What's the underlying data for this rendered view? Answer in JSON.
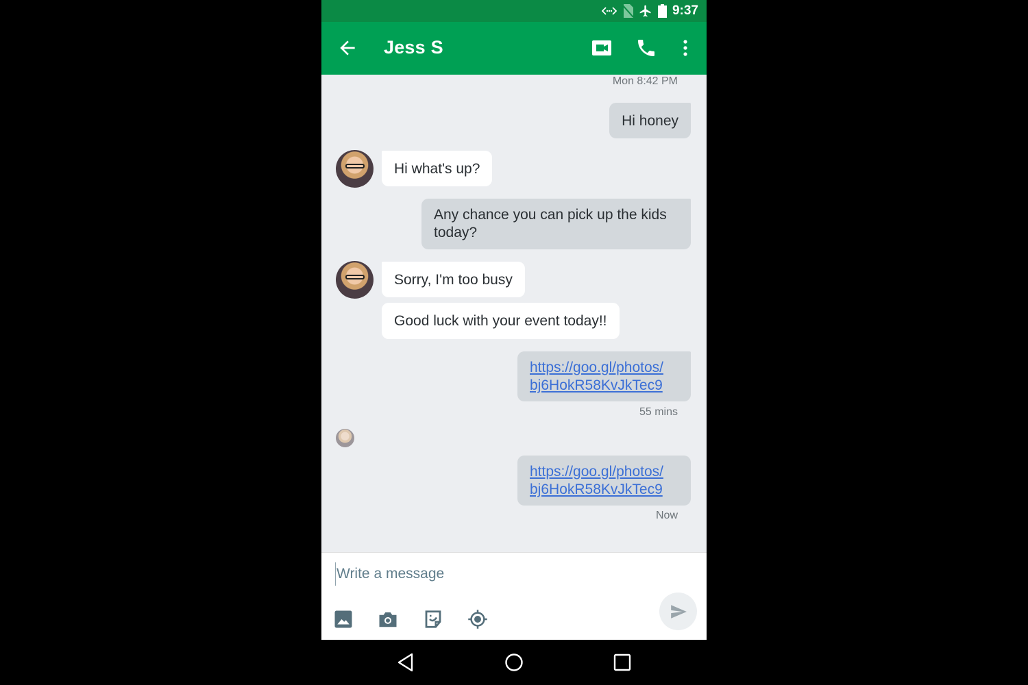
{
  "status_bar": {
    "time": "9:37",
    "icons": [
      "data-transfer-icon",
      "no-sim-icon",
      "airplane-mode-icon",
      "battery-icon"
    ]
  },
  "app_bar": {
    "title": "Jess S",
    "back_icon": "arrow-left-icon",
    "actions": [
      "video-call-icon",
      "phone-icon",
      "more-vert-icon"
    ],
    "color": "#00a054"
  },
  "conversation": {
    "timestamp_top": "Mon 8:42 PM",
    "messages": [
      {
        "direction": "outgoing",
        "text": "Hi honey"
      },
      {
        "direction": "incoming",
        "text": "Hi what's up?"
      },
      {
        "direction": "outgoing",
        "text": "Any chance you can pick up the kids today?"
      },
      {
        "direction": "incoming",
        "text": "Sorry, I'm too busy"
      },
      {
        "direction": "incoming",
        "text": "Good luck with your event today!!"
      },
      {
        "direction": "outgoing",
        "link_line1": "https://goo.gl/photos/",
        "link_line2": "bj6HokR58KvJkTec9",
        "time": "55 mins"
      },
      {
        "direction": "outgoing",
        "link_line1": "https://goo.gl/photos/",
        "link_line2": "bj6HokR58KvJkTec9",
        "time": "Now"
      }
    ]
  },
  "composer": {
    "placeholder": "Write a message",
    "value": "",
    "tools": [
      "image-icon",
      "camera-icon",
      "sticker-icon",
      "location-icon"
    ],
    "send_icon": "send-icon"
  },
  "nav_bar": {
    "buttons": [
      "back-triangle-icon",
      "home-circle-icon",
      "recents-square-icon"
    ]
  }
}
